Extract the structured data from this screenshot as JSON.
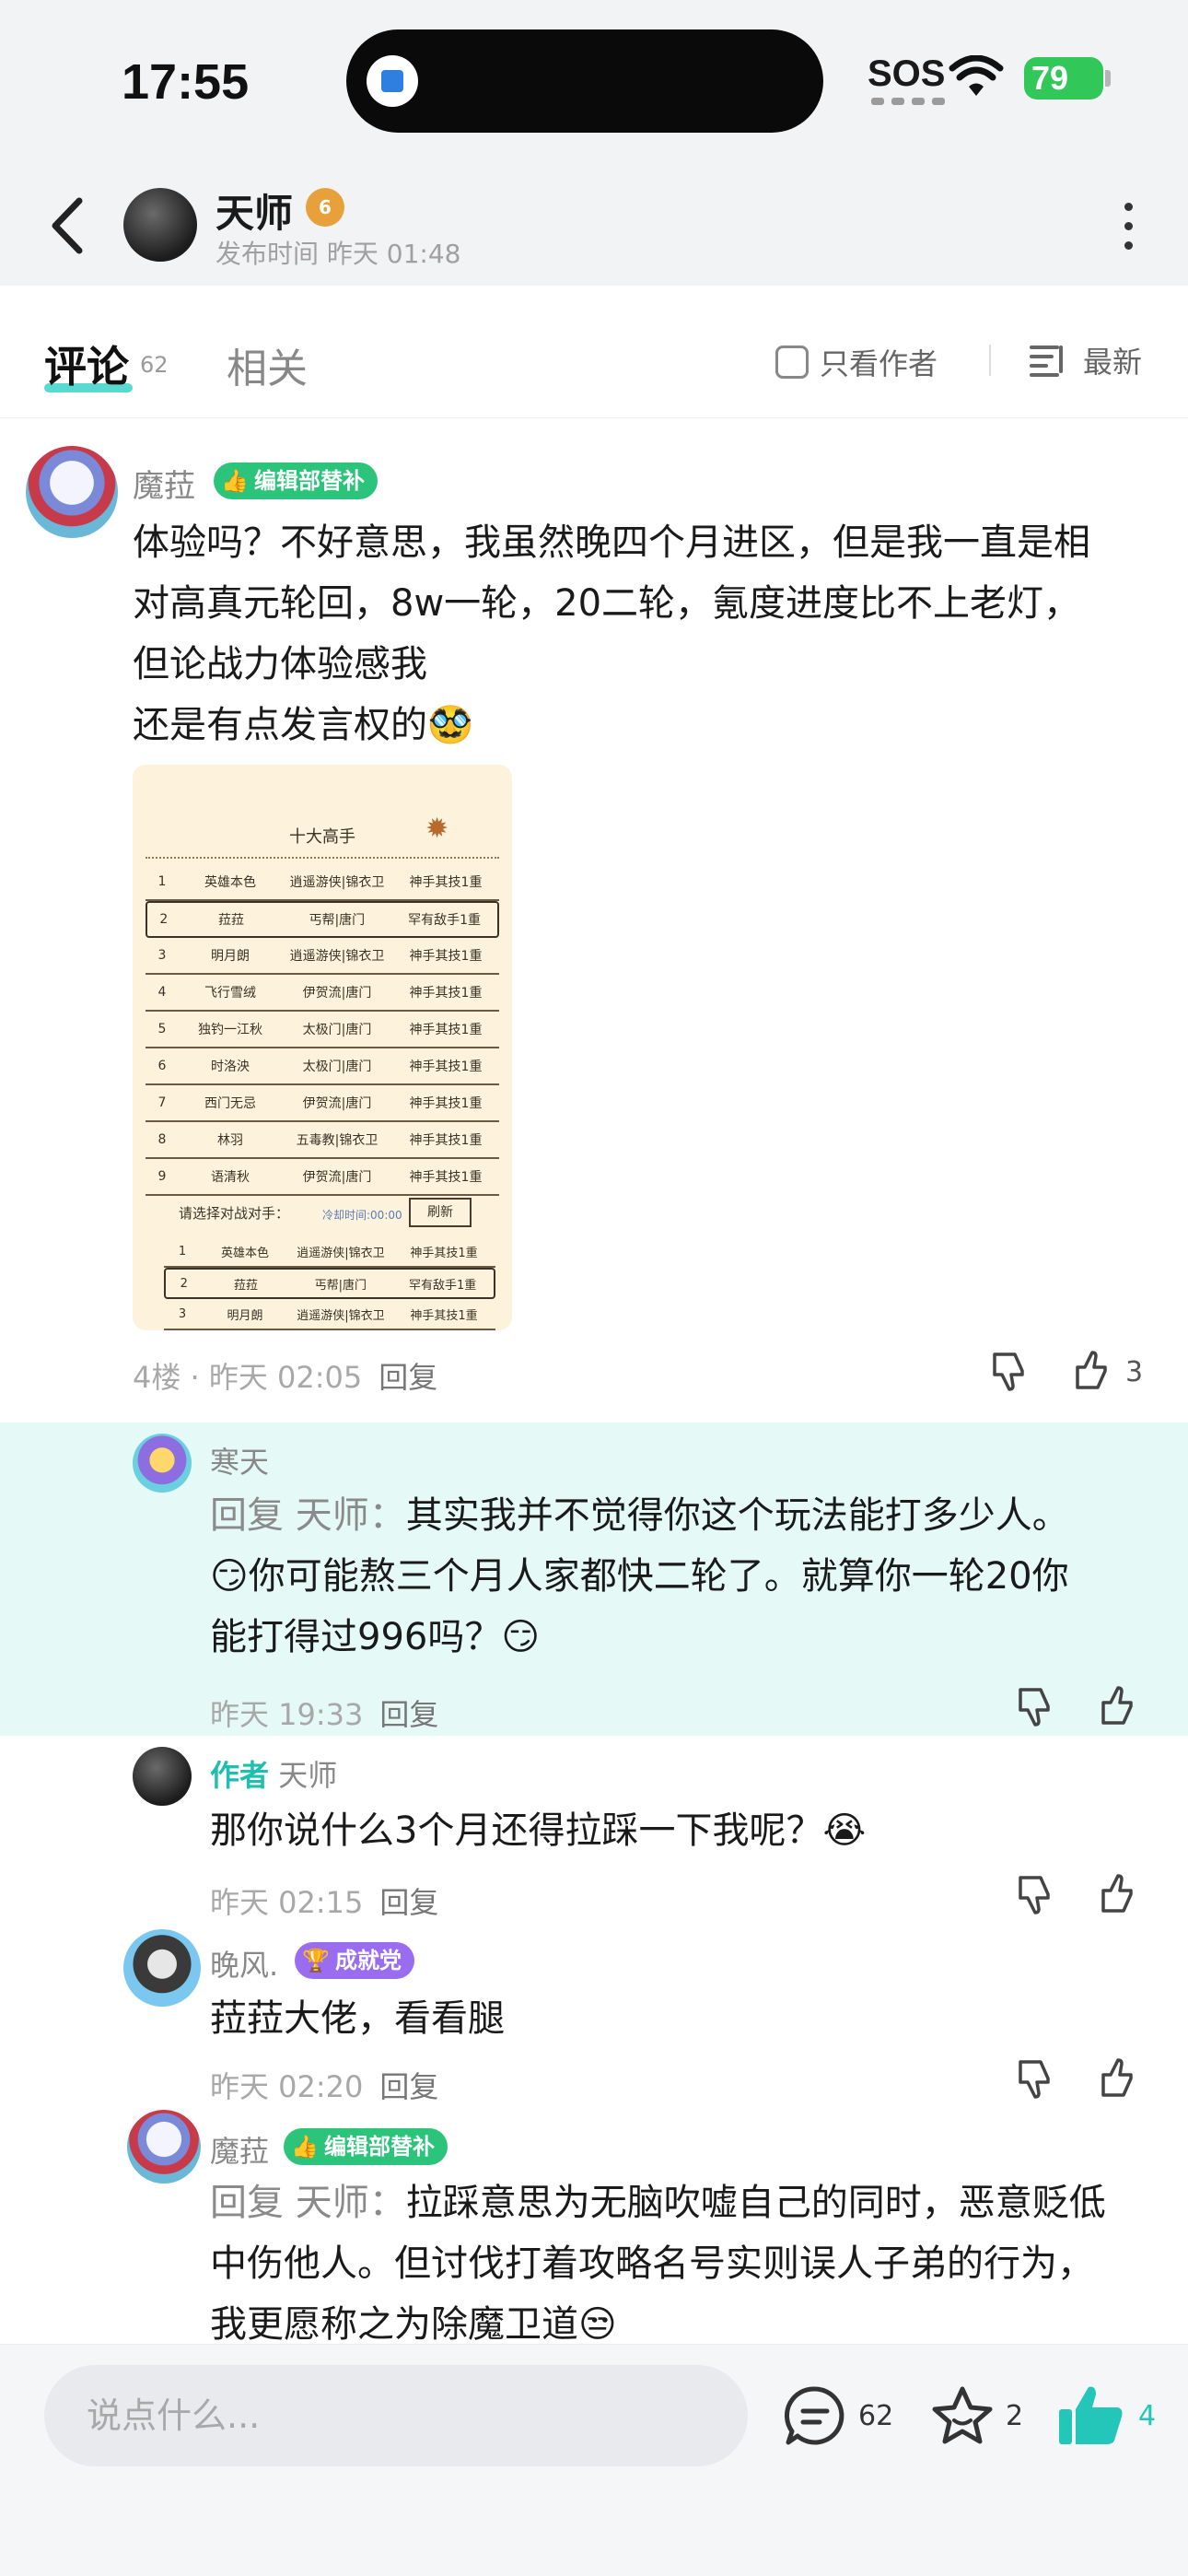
{
  "status_bar": {
    "time": "17:55",
    "sos": "SOS",
    "battery": "79"
  },
  "header": {
    "author_name": "天师",
    "level_badge": "6",
    "publish_time": "发布时间 昨天 01:48"
  },
  "tabs": {
    "comments_label": "评论",
    "comments_count": "62",
    "related_label": "相关",
    "only_author_label": "只看作者",
    "sort_label": "最新"
  },
  "comments": [
    {
      "name": "魔菈",
      "badge": "编辑部替补",
      "lines": [
        "体验吗？不好意思，我虽然晚四个月进区，但是我一直是相",
        "对高真元轮回，8w一轮，20二轮，氪度进度比不上老灯，",
        "但论战力体验感我",
        "还是有点发言权的🥸"
      ],
      "meta": "4楼 · 昨天 02:05",
      "reply_label": "回复",
      "likes": "3"
    }
  ],
  "table_image": {
    "title": "十大高手",
    "rows": [
      [
        "1",
        "英雄本色",
        "逍遥游侠|锦衣卫",
        "神手其技1重"
      ],
      [
        "2",
        "菈菈",
        "丐帮|唐门",
        "罕有敌手1重"
      ],
      [
        "3",
        "明月朗",
        "逍遥游侠|锦衣卫",
        "神手其技1重"
      ],
      [
        "4",
        "飞行雪绒",
        "伊贺流|唐门",
        "神手其技1重"
      ],
      [
        "5",
        "独钓一江秋",
        "太极门|唐门",
        "神手其技1重"
      ],
      [
        "6",
        "时洛泱",
        "太极门|唐门",
        "神手其技1重"
      ],
      [
        "7",
        "西门无忌",
        "伊贺流|唐门",
        "神手其技1重"
      ],
      [
        "8",
        "林羽",
        "五毒教|锦衣卫",
        "神手其技1重"
      ],
      [
        "9",
        "语清秋",
        "伊贺流|唐门",
        "神手其技1重"
      ]
    ],
    "prompt": "请选择对战对手：",
    "cooldown": "冷却时间:00:00",
    "refresh": "刷新",
    "rows2": [
      [
        "1",
        "英雄本色",
        "逍遥游侠|锦衣卫",
        "神手其技1重"
      ],
      [
        "2",
        "菈菈",
        "丐帮|唐门",
        "罕有敌手1重"
      ],
      [
        "3",
        "明月朗",
        "逍遥游侠|锦衣卫",
        "神手其技1重"
      ]
    ]
  },
  "replies": [
    {
      "name": "寒天",
      "reply_to": "回复 天师：",
      "lines": [
        "其实我并不觉得你这个玩法能打多少人。",
        "😏你可能熬三个月人家都快二轮了。就算你一轮20你",
        "能打得过996吗？😏"
      ],
      "meta": "昨天 19:33",
      "reply_label": "回复"
    },
    {
      "author_tag": "作者",
      "name": "天师",
      "lines": [
        "那你说什么3个月还得拉踩一下我呢？😭"
      ],
      "meta": "昨天 02:15",
      "reply_label": "回复"
    },
    {
      "name": "晚风.",
      "badge": "成就党",
      "lines": [
        "菈菈大佬，看看腿"
      ],
      "meta": "昨天 02:20",
      "reply_label": "回复"
    },
    {
      "name": "魔菈",
      "badge": "编辑部替补",
      "reply_to": "回复 天师：",
      "lines": [
        "拉踩意思为无脑吹嘘自己的同时，恶意贬低",
        "中伤他人。但讨伐打着攻略名号实则误人子弟的行为，",
        "我更愿称之为除魔卫道😒"
      ]
    }
  ],
  "bottom_bar": {
    "input_placeholder": "说点什么...",
    "comments_count": "62",
    "favorites_count": "2",
    "likes_count": "4",
    "accent_color": "#23c6b8"
  }
}
